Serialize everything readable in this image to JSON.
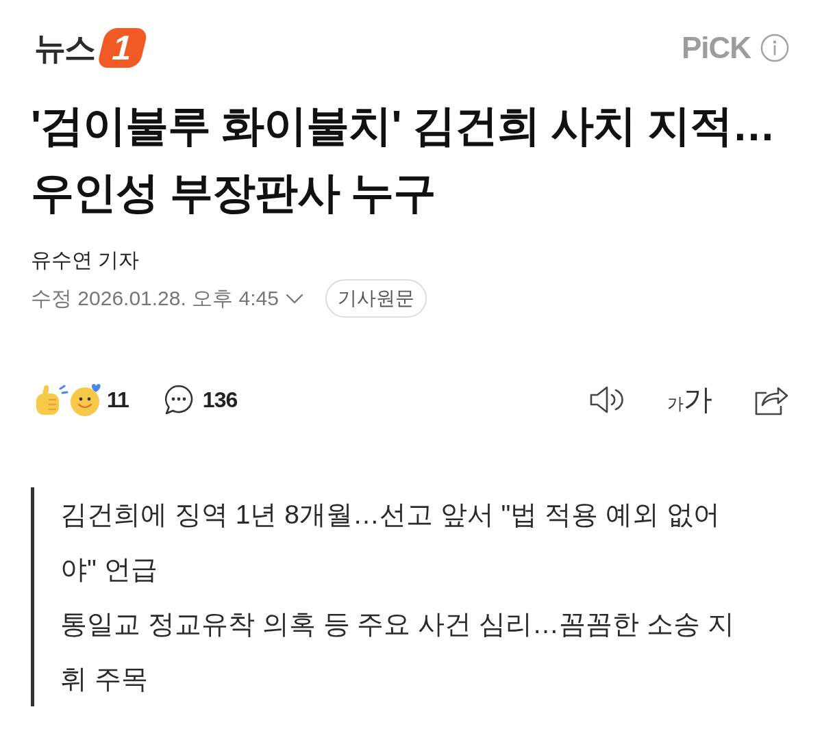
{
  "header": {
    "logo": {
      "text": "뉴스",
      "badge": "1"
    },
    "pick_label": "PiCK"
  },
  "article": {
    "headline": "'검이불루 화이불치' 김건희 사치 지적… 우인성 부장판사 누구",
    "byline": "유수연 기자",
    "timestamp": "수정 2026.01.28. 오후 4:45",
    "original_button": "기사원문"
  },
  "actions": {
    "reactions": {
      "count": "11"
    },
    "comments": {
      "count": "136"
    },
    "font_size": {
      "small": "가",
      "large": "가"
    }
  },
  "summary": [
    "김건희에 징역 1년 8개월…선고 앞서 \"법 적용 예외 없어야\" 언급",
    "통일교 정교유착 의혹 등 주요 사건 심리…꼼꼼한 소송 지휘 주목"
  ]
}
